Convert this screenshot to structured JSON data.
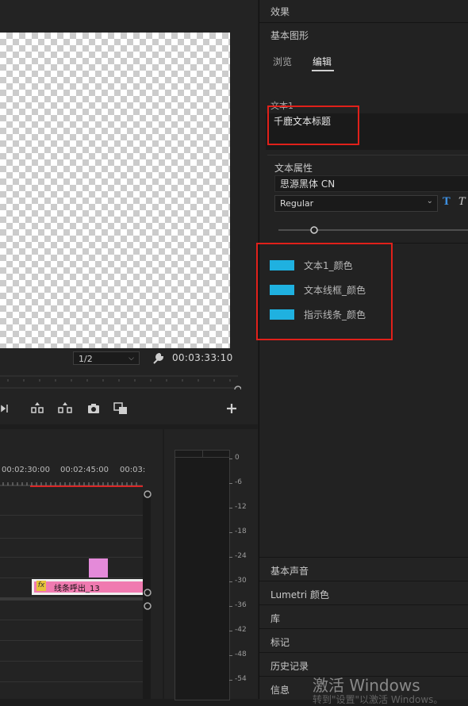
{
  "monitor": {
    "zoom": "1/2",
    "timecode": "00:03:33:10"
  },
  "timeline": {
    "ruler": [
      "00:02:30:00",
      "00:02:45:00",
      "00:03:"
    ],
    "clip_fx": "fx",
    "clip_label": "线条呼出_13",
    "clip_color": "#f07ab0"
  },
  "meter": {
    "db_labels": [
      "0",
      "-6",
      "-12",
      "-18",
      "-24",
      "-30",
      "-36",
      "-42",
      "-48",
      "-54"
    ]
  },
  "panel": {
    "effects": "效果",
    "essential_graphics": "基本图形",
    "tabs": [
      {
        "label": "浏览"
      },
      {
        "label": "编辑"
      }
    ],
    "text_layer_label": "文本1",
    "text_value": "千鹿文本标题",
    "text_props_label": "文本属性",
    "font_family": "思源黑体 CN",
    "font_style": "Regular",
    "color_items": [
      {
        "label": "文本1_颜色",
        "color": "#1fb1e0"
      },
      {
        "label": "文本线框_颜色",
        "color": "#1fb1e0"
      },
      {
        "label": "指示线条_颜色",
        "color": "#1fb1e0"
      }
    ],
    "bottom_items": [
      {
        "label": "基本声音"
      },
      {
        "label": "Lumetri 颜色"
      },
      {
        "label": "库"
      },
      {
        "label": "标记"
      },
      {
        "label": "历史记录"
      },
      {
        "label": "信息"
      }
    ]
  },
  "watermark": {
    "title": "激活 Windows",
    "subtitle": "转到\"设置\"以激活 Windows。"
  },
  "colors": {
    "accent_blue": "#1fb1e0",
    "highlight_red": "#e0201a",
    "playhead_red": "#d92626"
  }
}
